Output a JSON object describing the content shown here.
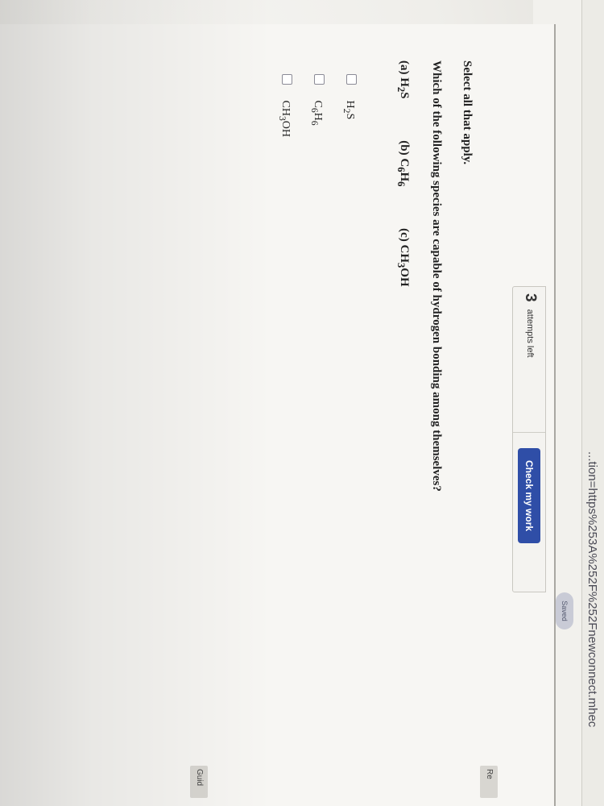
{
  "browser": {
    "url_fragment": "...tion=https%253A%252F%252Fnewconnect.mhec"
  },
  "toolbar": {
    "saved_label": "Saved"
  },
  "assignment": {
    "attempts_count": "3",
    "attempts_label": "attempts left",
    "check_button_label": "Check my work"
  },
  "question": {
    "instruction": "Select all that apply.",
    "prompt": "Which of the following species are capable of hydrogen bonding among themselves?",
    "listed_options": [
      {
        "letter": "(a)",
        "formula": "H",
        "sub": "2",
        "rest": "S"
      },
      {
        "letter": "(b)",
        "formula": "C",
        "sub": "6",
        "mid": "H",
        "sub2": "6"
      },
      {
        "letter": "(c)",
        "formula": "CH",
        "sub": "3",
        "rest": "OH"
      }
    ],
    "choices": [
      {
        "base": "H",
        "sub": "2",
        "rest": "S",
        "checked": false
      },
      {
        "base": "C",
        "sub": "6",
        "mid": "H",
        "sub2": "6",
        "checked": false
      },
      {
        "base": "CH",
        "sub": "3",
        "rest": "OH",
        "checked": false
      }
    ]
  },
  "side_tabs": {
    "tab1": "Re",
    "tab2": "Guid"
  }
}
